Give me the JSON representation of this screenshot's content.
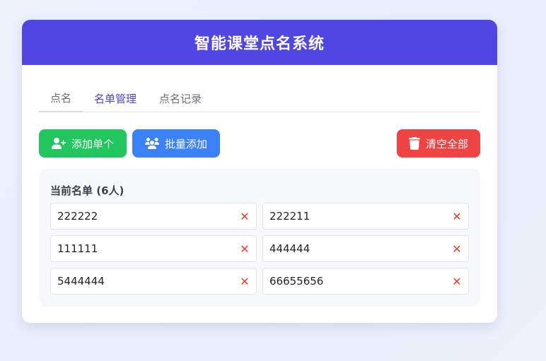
{
  "header": {
    "title": "智能课堂点名系统"
  },
  "tabs": [
    {
      "label": "点名"
    },
    {
      "label": "名单管理"
    },
    {
      "label": "点名记录"
    }
  ],
  "actions": {
    "add_single": "添加单个",
    "batch_add": "批量添加",
    "clear_all": "清空全部"
  },
  "roster": {
    "title": "当前名单 (6人)",
    "remove_symbol": "✕",
    "items": [
      {
        "name": "222222"
      },
      {
        "name": "222211"
      },
      {
        "name": "111111"
      },
      {
        "name": "444444"
      },
      {
        "name": "5444444"
      },
      {
        "name": "66655656"
      }
    ]
  },
  "colors": {
    "header": "#5046e4",
    "add_button": "#22c55e",
    "batch_button": "#3b82f6",
    "clear_button": "#ef4444",
    "active_tab": "#4b45c9",
    "remove_icon": "#e0413a"
  },
  "icons": {
    "add_single": "user-plus-icon",
    "batch_add": "users-icon",
    "clear_all": "trash-icon",
    "remove": "close-icon"
  }
}
